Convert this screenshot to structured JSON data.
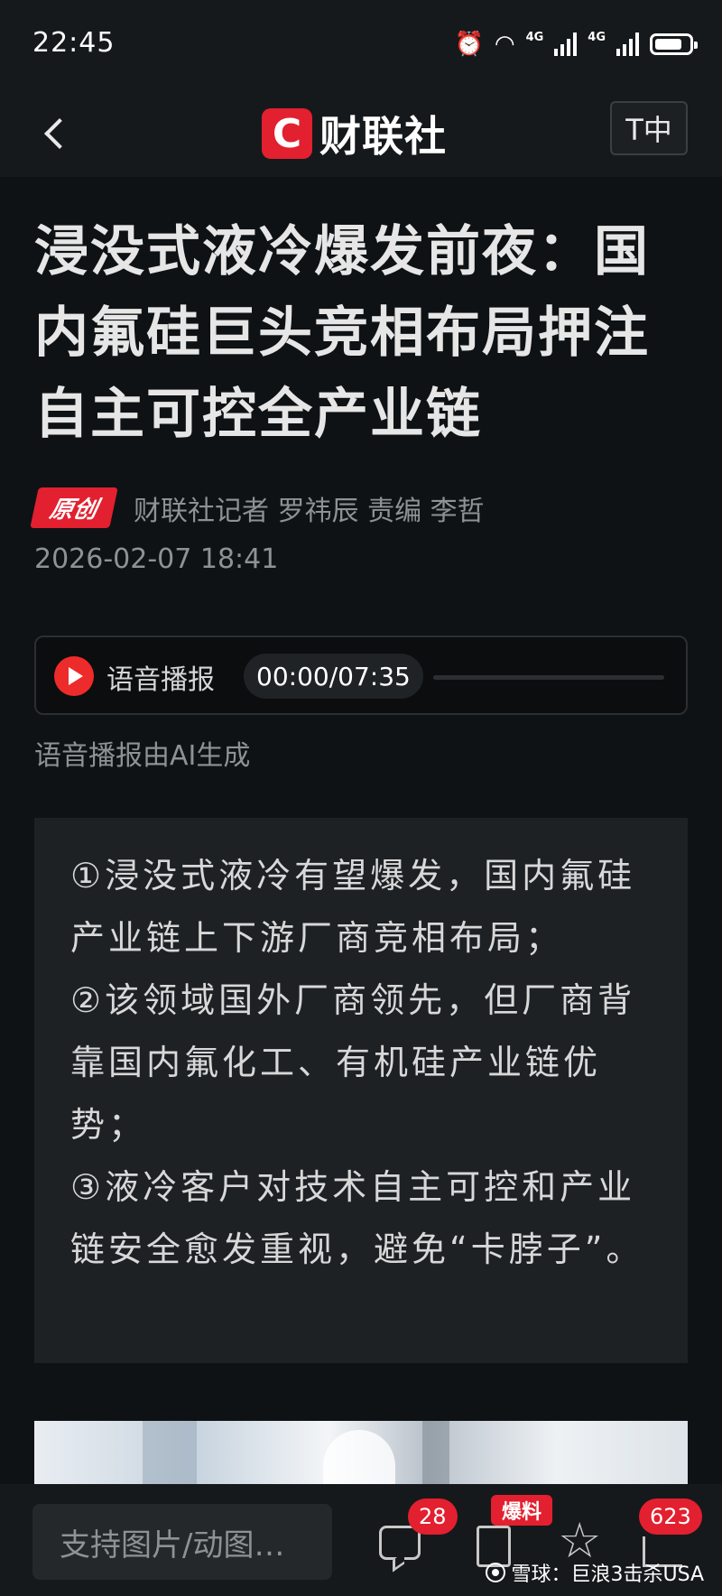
{
  "status_bar": {
    "time": "22:45",
    "net1": "4G",
    "net2": "4G",
    "battery_level": 0.8
  },
  "header": {
    "brand_logo": "C",
    "brand_name": "财联社",
    "font_button": "T中"
  },
  "article": {
    "title": "浸没式液冷爆发前夜：国内氟硅巨头竞相布局押注自主可控全产业链",
    "badge": "原创",
    "author_line": "财联社记者 罗祎辰  责编 李哲",
    "date": "2026-02-07 18:41",
    "audio": {
      "label": "语音播报",
      "time": "00:00/07:35",
      "progress": 0
    },
    "ai_note": "语音播报由AI生成",
    "summary": [
      "①浸没式液冷有望爆发，国内氟硅产业链上下游厂商竞相布局；",
      "②该领域国外厂商领先，但厂商背靠国内氟化工、有机硅产业链优势；",
      "③液冷客户对技术自主可控和产业链安全愈发重视，避免“卡脖子”。"
    ]
  },
  "bottom_bar": {
    "comment_placeholder": "支持图片/动图…",
    "comment_count": "28",
    "report_label": "爆料",
    "share_count": "623",
    "watermark": "雪球：巨浪3击杀USA"
  },
  "colors": {
    "accent": "#e2202f",
    "background": "#0f1214",
    "panel": "#1d2124"
  },
  "icons": [
    "back-icon",
    "play-icon",
    "comment-icon",
    "report-icon",
    "star-icon",
    "share-icon",
    "snowball-icon"
  ]
}
